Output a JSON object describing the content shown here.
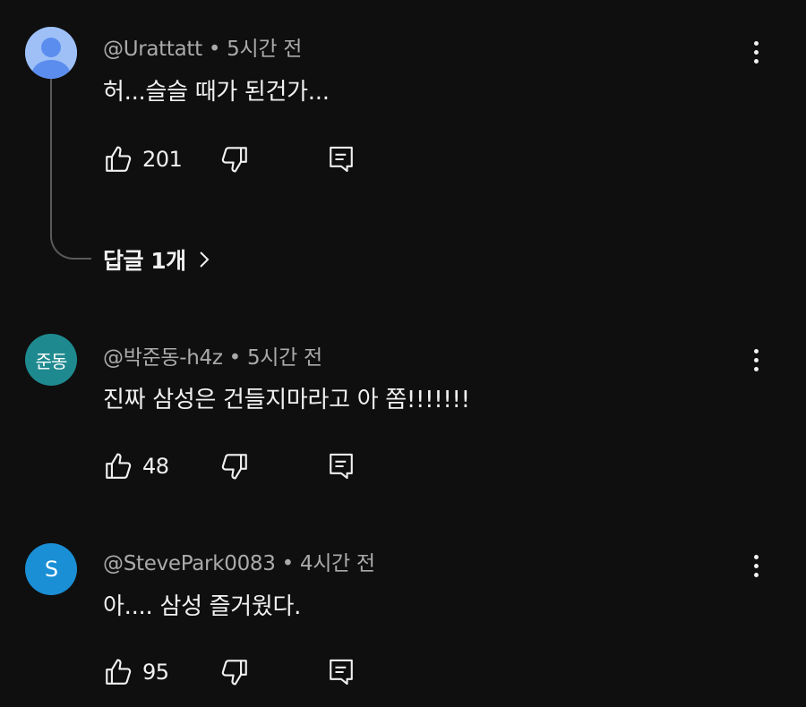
{
  "comments": [
    {
      "author": "@Urattatt",
      "time": "5시간 전",
      "text": "허...슬슬 때가 된건가...",
      "likes": "201",
      "avatar": {
        "type": "default-person",
        "color": "#5b8def"
      },
      "replies_label": "답글 1개"
    },
    {
      "author": "@박준동-h4z",
      "time": "5시간 전",
      "text": "진짜 삼성은 건들지마라고 아 쫌!!!!!!!",
      "likes": "48",
      "avatar": {
        "type": "initials",
        "initials": "준동",
        "color": "#1e8a8f"
      }
    },
    {
      "author": "@StevePark0083",
      "time": "4시간 전",
      "text": "아.... 삼성 즐거웠다.",
      "likes": "95",
      "avatar": {
        "type": "initials",
        "initials": "S",
        "color": "#1a8fd6"
      }
    }
  ],
  "separator": "•",
  "icons": {
    "like": "thumbs-up-icon",
    "dislike": "thumbs-down-icon",
    "reply": "reply-comment-icon",
    "more": "more-vertical-icon",
    "chevron": "chevron-right-icon"
  },
  "colors": {
    "background": "#0f0f0f",
    "text_primary": "#f1f1f1",
    "text_secondary": "#aaaaaa",
    "thread_line": "#5a5a5a"
  }
}
